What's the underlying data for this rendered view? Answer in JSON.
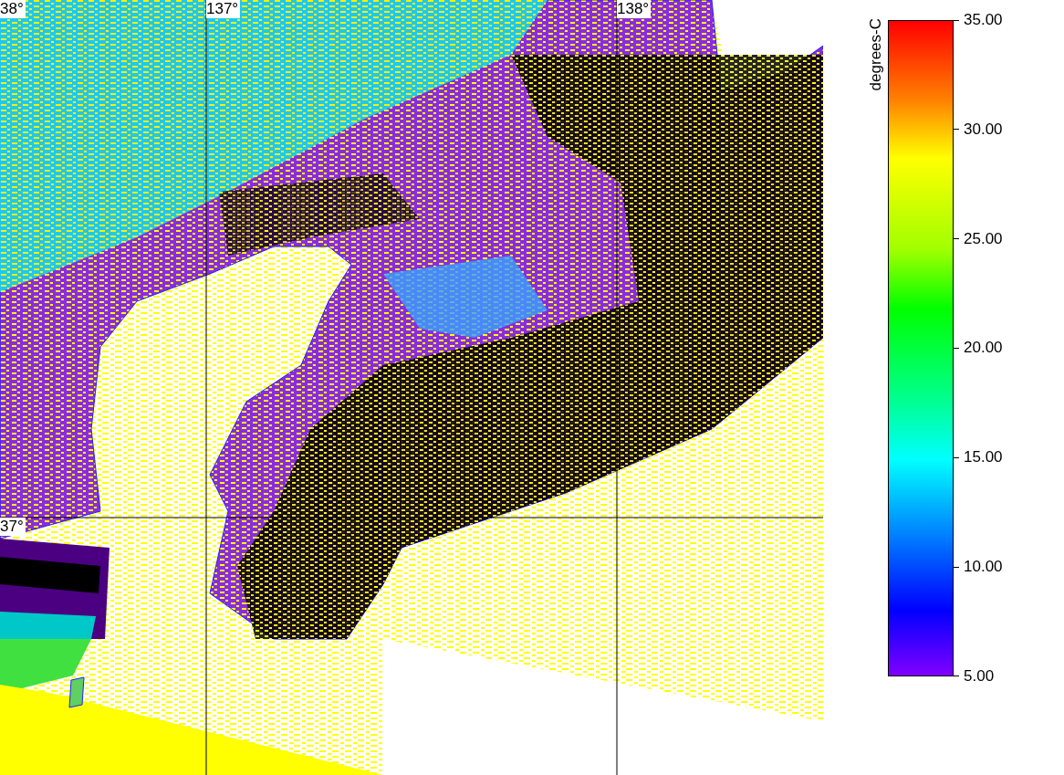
{
  "map": {
    "latitude_labels": [
      "38°",
      "37°"
    ],
    "longitude_labels": [
      "137°",
      "138°"
    ]
  },
  "colorbar": {
    "title": "degrees-C",
    "ticks": [
      "35.00",
      "30.00",
      "25.00",
      "20.00",
      "15.00",
      "10.00",
      "5.00"
    ]
  }
}
